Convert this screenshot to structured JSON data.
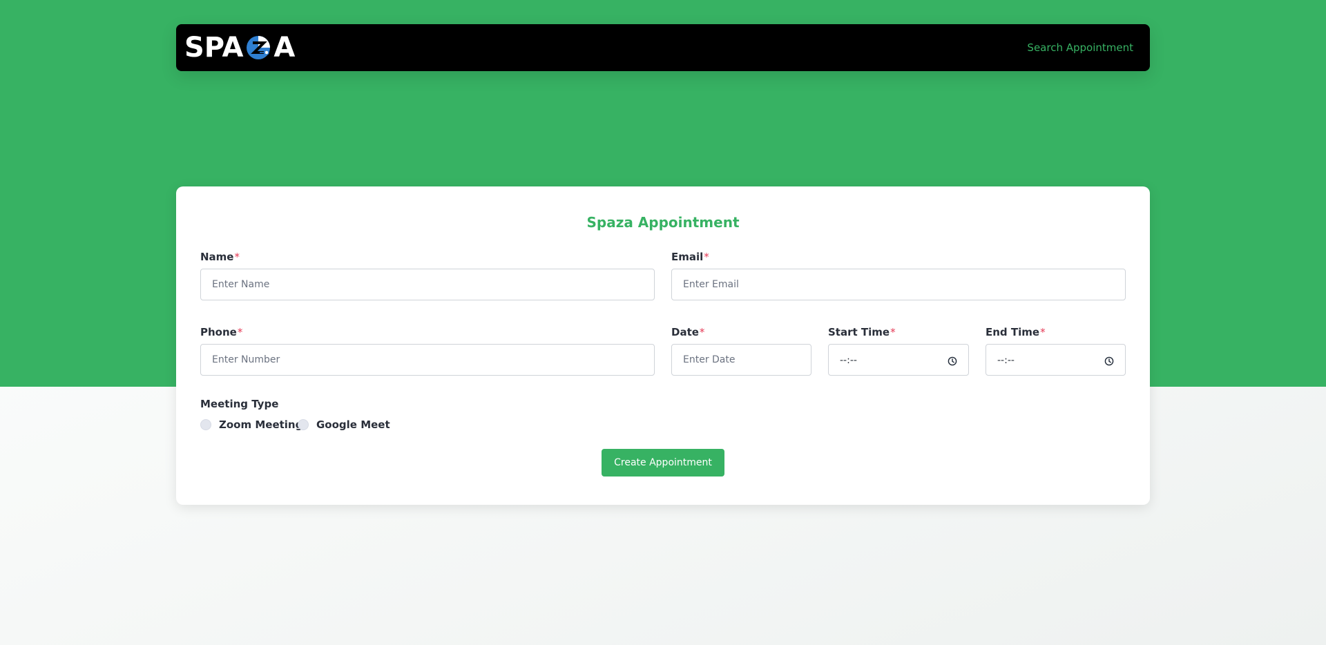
{
  "navbar": {
    "logo_left": "SPA",
    "logo_right": "A",
    "search_link": "Search Appointment"
  },
  "form": {
    "title": "Spaza Appointment",
    "required_mark": "*",
    "name": {
      "label": "Name",
      "placeholder": "Enter Name"
    },
    "email": {
      "label": "Email",
      "placeholder": "Enter Email"
    },
    "phone": {
      "label": "Phone",
      "placeholder": "Enter Number"
    },
    "date": {
      "label": "Date",
      "placeholder": "Enter Date"
    },
    "start_time": {
      "label": "Start Time",
      "value": "--:--"
    },
    "end_time": {
      "label": "End Time",
      "value": "--:--"
    },
    "meeting_type": {
      "label": "Meeting Type",
      "options": [
        "Zoom Meeting",
        "Google Meet"
      ]
    },
    "submit_label": "Create Appointment"
  },
  "colors": {
    "brand_green": "#37b263",
    "navbar_bg": "#000000",
    "required_red": "#e53955",
    "logo_blue": "#2f7fd1"
  },
  "icons": [
    "logo-mark-icon",
    "clock-icon"
  ]
}
